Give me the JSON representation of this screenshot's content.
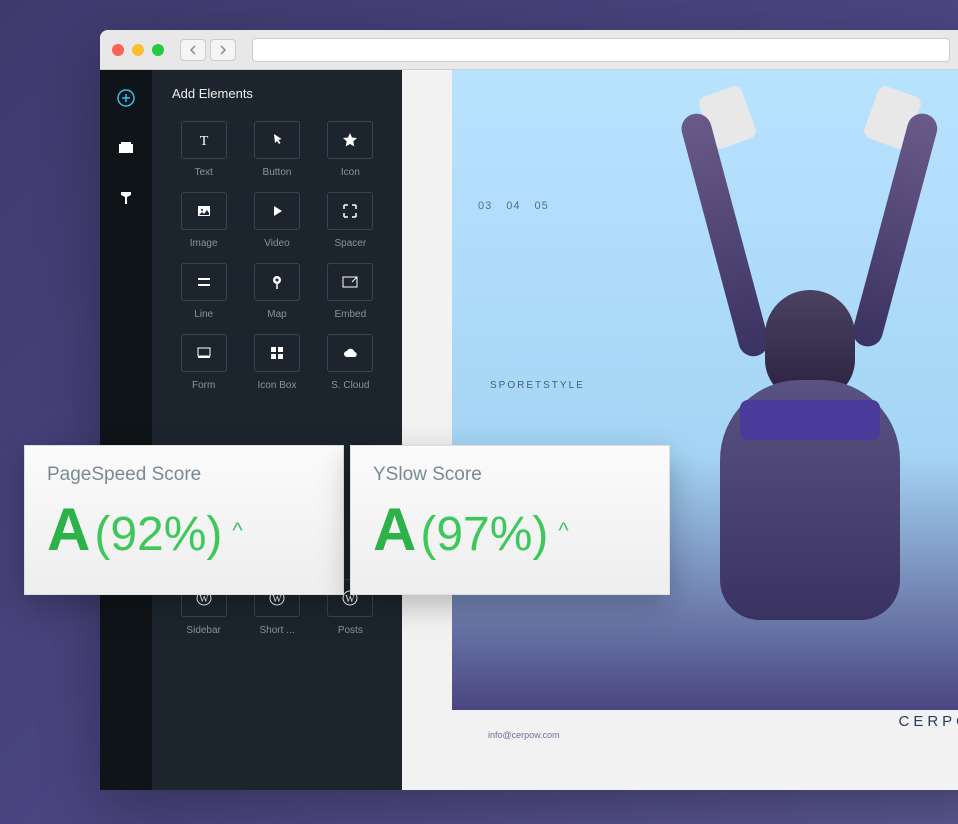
{
  "panel": {
    "title": "Add Elements"
  },
  "elements": [
    {
      "label": "Text",
      "icon": "text"
    },
    {
      "label": "Button",
      "icon": "pointer"
    },
    {
      "label": "Icon",
      "icon": "star"
    },
    {
      "label": "Image",
      "icon": "image"
    },
    {
      "label": "Video",
      "icon": "play"
    },
    {
      "label": "Spacer",
      "icon": "expand"
    },
    {
      "label": "Line",
      "icon": "lines"
    },
    {
      "label": "Map",
      "icon": "pin"
    },
    {
      "label": "Embed",
      "icon": "embed"
    },
    {
      "label": "Form",
      "icon": "form"
    },
    {
      "label": "Icon Box",
      "icon": "grid"
    },
    {
      "label": "S. Cloud",
      "icon": "cloud"
    },
    {
      "label": "Sidebar",
      "icon": "wp"
    },
    {
      "label": "Short ...",
      "icon": "wp"
    },
    {
      "label": "Posts",
      "icon": "wp"
    }
  ],
  "canvas": {
    "page_numbers": [
      "03",
      "04",
      "05"
    ],
    "sport_label": "SPORETSTYLE",
    "email": "info@cerpow.com",
    "brand": "CERPOW"
  },
  "scores": [
    {
      "title": "PageSpeed Score",
      "grade": "A",
      "percent": "(92%)"
    },
    {
      "title": "YSlow Score",
      "grade": "A",
      "percent": "(97%)"
    }
  ]
}
